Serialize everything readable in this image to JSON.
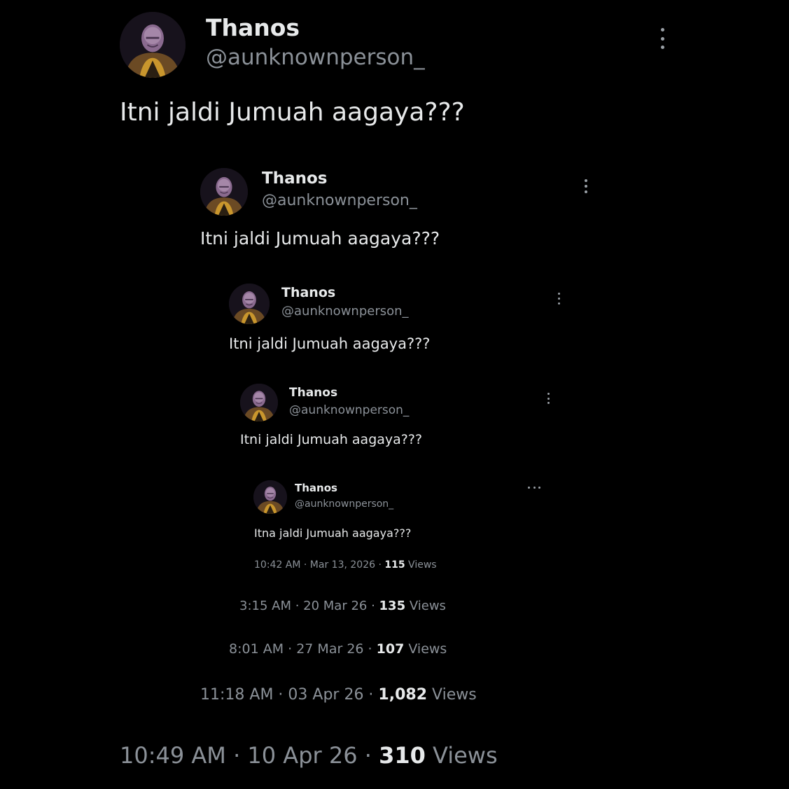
{
  "tweets": [
    {
      "name": "Thanos",
      "handle": "@aunknownperson_",
      "text": "Itni jaldi Jumuah aagaya???",
      "time": "10:49 AM · 10 Apr 26 · ",
      "views_count": "310",
      "views_label": " Views"
    },
    {
      "name": "Thanos",
      "handle": "@aunknownperson_",
      "text": "Itni jaldi Jumuah aagaya???",
      "time": "11:18 AM · 03 Apr 26 · ",
      "views_count": "1,082",
      "views_label": " Views"
    },
    {
      "name": "Thanos",
      "handle": "@aunknownperson_",
      "text": "Itni jaldi Jumuah aagaya???",
      "time": "8:01 AM · 27 Mar 26 · ",
      "views_count": "107",
      "views_label": " Views"
    },
    {
      "name": "Thanos",
      "handle": "@aunknownperson_",
      "text": "Itni jaldi Jumuah aagaya???",
      "time": "3:15 AM · 20 Mar 26 · ",
      "views_count": "135",
      "views_label": " Views"
    },
    {
      "name": "Thanos",
      "handle": "@aunknownperson_",
      "text": "Itna jaldi Jumuah aagaya???",
      "time": "10:42 AM · Mar 13, 2026 · ",
      "views_count": "115",
      "views_label": " Views"
    }
  ],
  "icons": {
    "more_vertical": "more-vertical-icon",
    "more_horizontal": "more-horizontal-icon"
  },
  "colors": {
    "background": "#000000",
    "primary_text": "#e7e9ea",
    "secondary_text": "#8b9198"
  }
}
